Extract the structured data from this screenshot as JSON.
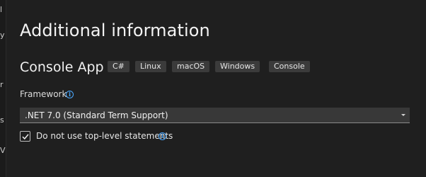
{
  "dialog": {
    "title": "Additional information",
    "template_name": "Console App",
    "tags": [
      "C#",
      "Linux",
      "macOS",
      "Windows",
      "Console"
    ]
  },
  "framework": {
    "label": "Framework",
    "selected": ".NET 7.0 (Standard Term Support)"
  },
  "top_level_statements": {
    "label": "Do not use top-level statements",
    "checked": true
  },
  "left_strip": {
    "chars": [
      "l",
      "y",
      "r",
      "s",
      "V"
    ]
  },
  "colors": {
    "background": "#1f1f1f",
    "accent": "#4aa8ff",
    "tag_background": "#3b3b3b",
    "select_background": "#383838"
  },
  "icons": [
    "info-icon",
    "chevron-down-icon",
    "checkmark-icon"
  ]
}
